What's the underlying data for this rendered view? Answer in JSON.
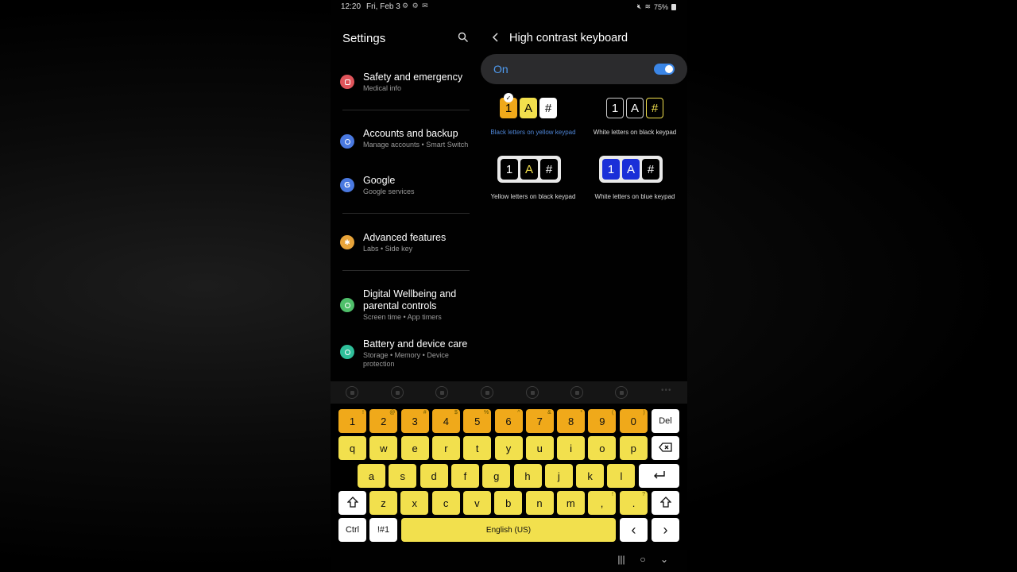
{
  "status_bar": {
    "time": "12:20",
    "date": "Fri, Feb 3",
    "notification_icons": "⚙ ⚙ ✉",
    "battery": "75%"
  },
  "settings": {
    "title": "Settings",
    "items": [
      {
        "title": "Safety and emergency",
        "subtitle": "Medical info",
        "icon": "alert-icon",
        "color": "#e0555b"
      },
      {
        "title": "Accounts and backup",
        "subtitle": "Manage accounts  •  Smart Switch",
        "icon": "sync-icon",
        "color": "#4a79e0"
      },
      {
        "title": "Google",
        "subtitle": "Google services",
        "icon": "google-icon",
        "color": "#4a79e0"
      },
      {
        "title": "Advanced features",
        "subtitle": "Labs  •  Side key",
        "icon": "star-icon",
        "color": "#e8a43a"
      },
      {
        "title": "Digital Wellbeing and parental controls",
        "subtitle": "Screen time  •  App timers",
        "icon": "wellbeing-icon",
        "color": "#4fbf6a"
      },
      {
        "title": "Battery and device care",
        "subtitle": "Storage  •  Memory  •  Device protection",
        "icon": "device-care-icon",
        "color": "#2fbf9a"
      }
    ]
  },
  "detail": {
    "title": "High contrast keyboard",
    "toggle_label": "On",
    "toggle_on": true,
    "options": [
      {
        "label": "Black letters on yellow keypad",
        "selected": true,
        "keys": [
          "1",
          "A",
          "#"
        ]
      },
      {
        "label": "White letters on black keypad",
        "selected": false,
        "keys": [
          "1",
          "A",
          "#"
        ]
      },
      {
        "label": "Yellow letters on black keypad",
        "selected": false,
        "keys": [
          "1",
          "A",
          "#"
        ]
      },
      {
        "label": "White letters on blue keypad",
        "selected": false,
        "keys": [
          "1",
          "A",
          "#"
        ]
      }
    ]
  },
  "keyboard": {
    "number_row": [
      {
        "k": "1",
        "h": "!"
      },
      {
        "k": "2",
        "h": "@"
      },
      {
        "k": "3",
        "h": "#"
      },
      {
        "k": "4",
        "h": "$"
      },
      {
        "k": "5",
        "h": "%"
      },
      {
        "k": "6",
        "h": "^"
      },
      {
        "k": "7",
        "h": "&"
      },
      {
        "k": "8",
        "h": "*"
      },
      {
        "k": "9",
        "h": "("
      },
      {
        "k": "0",
        "h": ")"
      }
    ],
    "del_label": "Del",
    "row1": [
      "q",
      "w",
      "e",
      "r",
      "t",
      "y",
      "u",
      "i",
      "o",
      "p"
    ],
    "row2": [
      "a",
      "s",
      "d",
      "f",
      "g",
      "h",
      "j",
      "k",
      "l"
    ],
    "row3": [
      "z",
      "x",
      "c",
      "v",
      "b",
      "n",
      "m"
    ],
    "comma_key": {
      "k": ",",
      "h": "!"
    },
    "period_key": {
      "k": ".",
      "h": "?"
    },
    "ctrl_label": "Ctrl",
    "symbols_label": "!#1",
    "space_label": "English (US)",
    "left_arrow": "‹",
    "right_arrow": "›"
  },
  "nav": {
    "recents": "|||",
    "home": "○",
    "back": "⌄"
  }
}
